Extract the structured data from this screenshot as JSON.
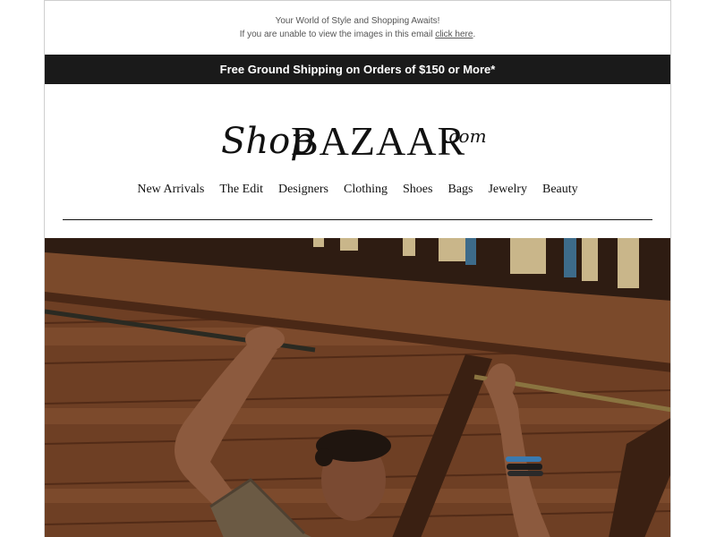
{
  "preheader": {
    "tagline": "Your World of Style and Shopping Awaits!",
    "view_text": "If you are unable to view the images in this email ",
    "view_link": "click here",
    "view_suffix": "."
  },
  "promo": {
    "text": "Free Ground Shipping on Orders of $150 or More*"
  },
  "logo": {
    "script": "Shop",
    "main": "BAZAAR",
    "suffix": ".com"
  },
  "nav": {
    "items": [
      "New Arrivals",
      "The Edit",
      "Designers",
      "Clothing",
      "Shoes",
      "Bags",
      "Jewelry",
      "Beauty"
    ]
  },
  "colors": {
    "promo_bg": "#1a1a1a",
    "text": "#111111",
    "wood": "#7a4a2e"
  }
}
